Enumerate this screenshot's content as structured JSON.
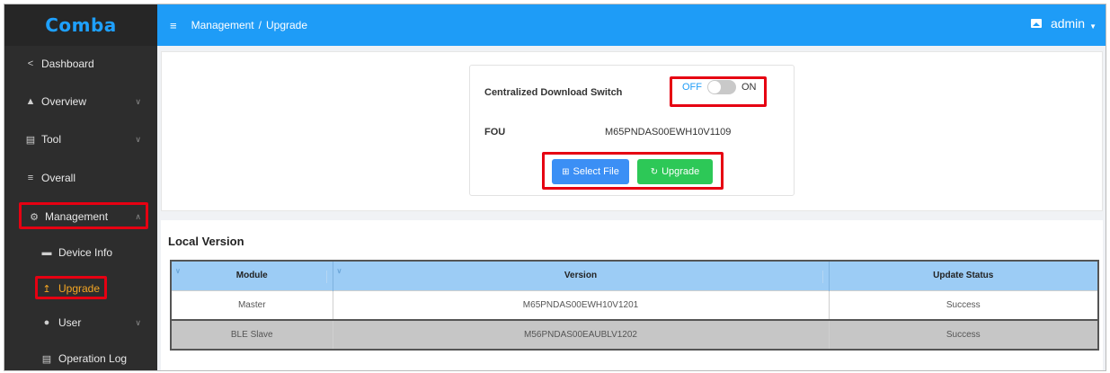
{
  "brand": {
    "logo": "Comba"
  },
  "sidebar": {
    "items": [
      {
        "label": "Dashboard",
        "icon": "share-icon"
      },
      {
        "label": "Overview",
        "icon": "home-icon"
      },
      {
        "label": "Tool",
        "icon": "toolbox-icon"
      },
      {
        "label": "Overall",
        "icon": "sliders-icon"
      },
      {
        "label": "Management",
        "icon": "gear-icon"
      }
    ],
    "subitems": [
      {
        "label": "Device Info",
        "icon": "monitor-icon"
      },
      {
        "label": "Upgrade",
        "icon": "upload-icon"
      },
      {
        "label": "User",
        "icon": "user-icon"
      },
      {
        "label": "Operation Log",
        "icon": "document-icon"
      }
    ]
  },
  "header": {
    "breadcrumb": [
      "Management",
      "Upgrade"
    ],
    "breadcrumb_sep": "/",
    "user": "admin"
  },
  "upgrade": {
    "switch_label": "Centralized Download Switch",
    "switch_off": "OFF",
    "switch_on": "ON",
    "switch_state": "off",
    "fou_label": "FOU",
    "fou_value": "M65PNDAS00EWH10V1109",
    "select_file_label": "Select File",
    "upgrade_label": "Upgrade"
  },
  "local_version": {
    "title": "Local Version",
    "columns": [
      "Module",
      "Version",
      "Update Status"
    ],
    "rows": [
      {
        "module": "Master",
        "version": "M65PNDAS00EWH10V1201",
        "status": "Success"
      },
      {
        "module": "BLE Slave",
        "version": "M56PNDAS00EAUBLV1202",
        "status": "Success"
      }
    ]
  },
  "colors": {
    "sidebar_bg": "#2d2d2d",
    "topbar_bg": "#1e9cf7",
    "active_item": "#f5a623",
    "highlight_box": "#e60012",
    "select_button": "#3b8ff5",
    "upgrade_button": "#2dc857",
    "table_header": "#9cccf5"
  }
}
